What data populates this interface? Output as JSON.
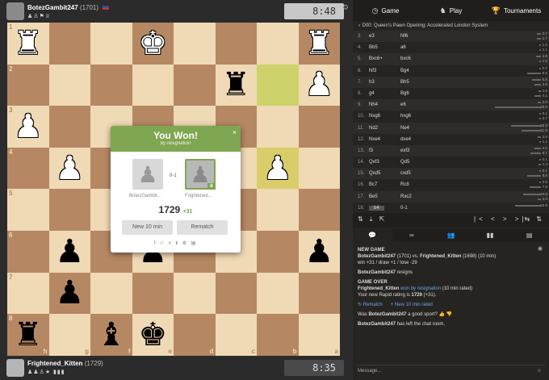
{
  "top_player": {
    "name": "BotezGambit247",
    "rating": "(1701)",
    "badges": "♟♙⚑♕",
    "clock": "8:48"
  },
  "bottom_player": {
    "name": "Frightened_Kitten",
    "rating": "(1729)",
    "badges": "♟♟♙★ ▮▮▮",
    "clock": "8:35"
  },
  "board": {
    "ranks": [
      "1",
      "2",
      "3",
      "4",
      "5",
      "6",
      "7",
      "8"
    ],
    "files": [
      "h",
      "g",
      "f",
      "e",
      "d",
      "c",
      "b",
      "a"
    ]
  },
  "modal": {
    "title": "You Won!",
    "subtitle": "by resignation",
    "close": "×",
    "score": "0-1",
    "left_name": "BotezGambit...",
    "right_name": "Frightened...",
    "rating": "1729",
    "rating_delta": "+31",
    "new_game_label": "New 10 min",
    "rematch_label": "Rematch",
    "share_icons": "f ✓ < ℹ ⚙ ▤"
  },
  "tabs": {
    "game": "Game",
    "play": "Play",
    "tournaments": "Tournaments"
  },
  "opening": "D00: Queen's Pawn Opening: Accelerated London System",
  "moves": [
    {
      "num": "3.",
      "white": "e3",
      "black": "Nf6",
      "ev1": "2.7",
      "ev2": "2.7"
    },
    {
      "num": "4.",
      "white": "Bb5",
      "black": "a6",
      "ev1": "1.2",
      "ev2": "1.1"
    },
    {
      "num": "5.",
      "white": "Bxc6+",
      "black": "bxc6",
      "ev1": "2.8",
      "ev2": "1.0"
    },
    {
      "num": "6.",
      "white": "Nf3",
      "black": "Bg4",
      "ev1": "0.7",
      "ev2": "8.5"
    },
    {
      "num": "7.",
      "white": "h3",
      "black": "Bh5",
      "ev1": "5.5",
      "ev2": "3.9"
    },
    {
      "num": "8.",
      "white": "g4",
      "black": "Bg6",
      "ev1": "1.6",
      "ev2": "4.1"
    },
    {
      "num": "9.",
      "white": "Nh4",
      "black": "e6",
      "ev1": "2.0",
      "ev2": "28.6"
    },
    {
      "num": "10.",
      "white": "Nxg6",
      "black": "hxg6",
      "ev1": "0.1",
      "ev2": "0.7"
    },
    {
      "num": "11.",
      "white": "Nd2",
      "black": "Ne4",
      "ev1": "18.3",
      "ev2": "11.9"
    },
    {
      "num": "12.",
      "white": "Nxe4",
      "black": "dxe4",
      "ev1": "2.0",
      "ev2": "1.1"
    },
    {
      "num": "13.",
      "white": "f3",
      "black": "exf3",
      "ev1": "4.1",
      "ev2": "6.7"
    },
    {
      "num": "14.",
      "white": "Qxf3",
      "black": "Qd5",
      "ev1": "0.1",
      "ev2": "1.4"
    },
    {
      "num": "15.",
      "white": "Qxd5",
      "black": "cxd5",
      "ev1": "0.1",
      "ev2": "8.5"
    },
    {
      "num": "16.",
      "white": "Bc7",
      "black": "Rc8",
      "ev1": "0.6",
      "ev2": "7.0"
    },
    {
      "num": "17.",
      "white": "Be5",
      "black": "Rxc2",
      "ev1": "10.8",
      "ev2": "2.0"
    },
    {
      "num": "18.",
      "white": "b4",
      "black": "0-1",
      "ev1": "15.9",
      "ev2": ""
    }
  ],
  "controls": {
    "left": "⇅ ⤓ ⇱",
    "middle": "|< < > >|",
    "right": "⇆ ⇅"
  },
  "chat_tabs": [
    "💬",
    "∞",
    "👥",
    "▮▮",
    "▤"
  ],
  "chat": {
    "new_game_header": "NEW GAME",
    "vs_line_white": "BotezGambit247",
    "vs_line_white_rating": "(1701) vs.",
    "vs_line_black": "Frightened_Kitten",
    "vs_line_black_rating": "(1698) (10 min)",
    "win_line": "win +31 / draw +1 / lose -29",
    "resigns_name": "BotezGambit247",
    "resigns_text": "resigns",
    "game_over_header": "GAME OVER",
    "winner": "Frightened_Kitten",
    "won_by": "won by resignation",
    "rated": "(10 min rated)",
    "new_rating": "Your new Rapid rating is",
    "new_rating_value": "1729",
    "new_rating_delta": "(+31).",
    "rematch_action": "↻ Rematch",
    "new_game_action": "+ New 10 min rated",
    "msg1_name": "BotezGambit247",
    "msg1_text": "a good sport?",
    "msg1_prefix": "Was",
    "msg2_name": "BotezGambit247",
    "msg2_text": "has left the chat room.",
    "input_placeholder": "Message..."
  }
}
